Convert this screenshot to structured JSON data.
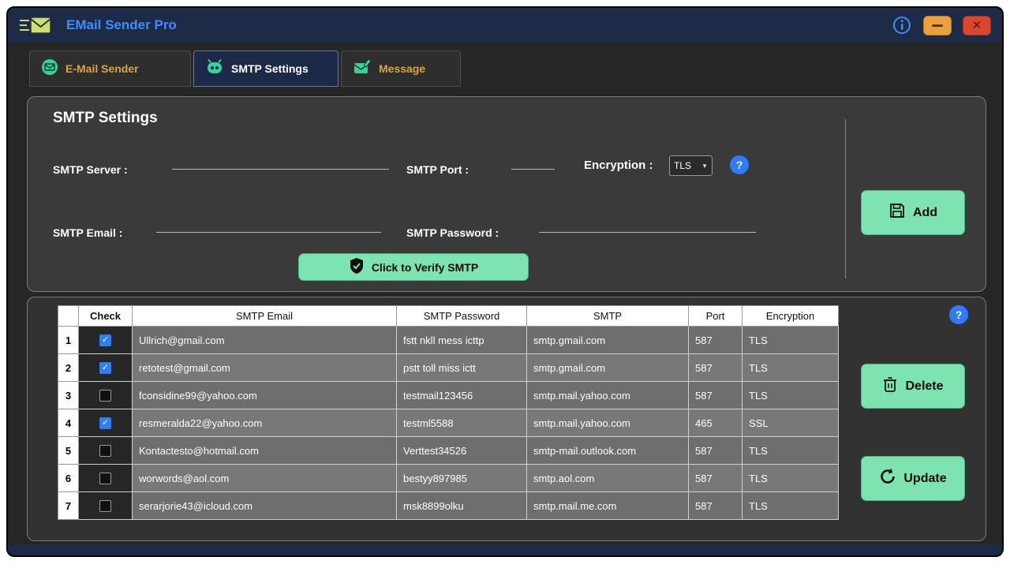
{
  "titlebar": {
    "title": "EMail Sender Pro"
  },
  "tabs": [
    {
      "label": "E-Mail Sender",
      "active": false
    },
    {
      "label": "SMTP Settings",
      "active": true
    },
    {
      "label": "Message",
      "active": false
    }
  ],
  "form": {
    "heading": "SMTP Settings",
    "server_label": "SMTP Server :",
    "port_label": "SMTP Port :",
    "encryption_label": "Encryption :",
    "encryption_value": "TLS",
    "email_label": "SMTP Email :",
    "password_label": "SMTP Password :",
    "verify_label": "Click to Verify SMTP",
    "add_label": "Add"
  },
  "table": {
    "headers": [
      "Check",
      "SMTP Email",
      "SMTP Password",
      "SMTP",
      "Port",
      "Encryption"
    ],
    "rows": [
      {
        "num": "1",
        "checked": true,
        "email": "Ullrich@gmail.com",
        "password": "fstt nkll mess icttp",
        "smtp": "smtp.gmail.com",
        "port": "587",
        "encryption": "TLS"
      },
      {
        "num": "2",
        "checked": true,
        "email": "retotest@gmail.com",
        "password": "pstt toll miss ictt",
        "smtp": "smtp.gmail.com",
        "port": "587",
        "encryption": "TLS"
      },
      {
        "num": "3",
        "checked": false,
        "email": "fconsidine99@yahoo.com",
        "password": "testmail123456",
        "smtp": "smtp.mail.yahoo.com",
        "port": "587",
        "encryption": "TLS"
      },
      {
        "num": "4",
        "checked": true,
        "email": "resmeralda22@yahoo.com",
        "password": "testml5588",
        "smtp": "smtp.mail.yahoo.com",
        "port": "465",
        "encryption": "SSL"
      },
      {
        "num": "5",
        "checked": false,
        "email": "Kontactesto@hotmail.com",
        "password": "Verttest34526",
        "smtp": "smtp-mail.outlook.com",
        "port": "587",
        "encryption": "TLS"
      },
      {
        "num": "6",
        "checked": false,
        "email": "worwords@aol.com",
        "password": "bestyy897985",
        "smtp": "smtp.aol.com",
        "port": "587",
        "encryption": "TLS"
      },
      {
        "num": "7",
        "checked": false,
        "email": "serarjorie43@icloud.com",
        "password": "msk8899olku",
        "smtp": "smtp.mail.me.com",
        "port": "587",
        "encryption": "TLS"
      }
    ]
  },
  "actions": {
    "delete_label": "Delete",
    "update_label": "Update"
  },
  "colors": {
    "accent_mint": "#7de3b0",
    "accent_blue": "#2e7bff",
    "titlebar_navy": "#1d2b47",
    "tab_orange": "#dba43c",
    "checked_blue": "#2f80ed"
  }
}
